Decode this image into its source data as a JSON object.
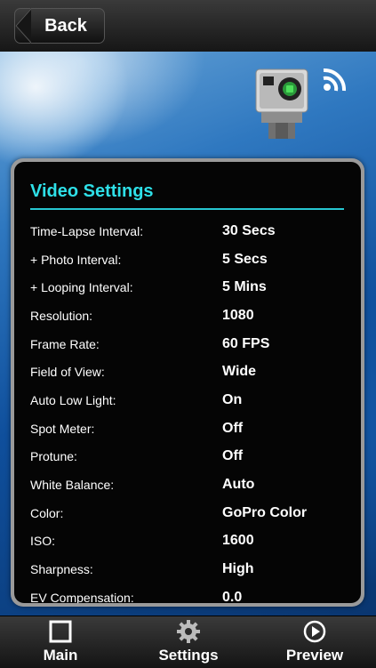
{
  "nav": {
    "back_label": "Back"
  },
  "panel": {
    "title": "Video Settings",
    "rows": [
      {
        "label": "Time-Lapse Interval:",
        "value": "30 Secs"
      },
      {
        "label": "+ Photo Interval:",
        "value": "5 Secs"
      },
      {
        "label": "+ Looping Interval:",
        "value": "5 Mins"
      },
      {
        "label": "Resolution:",
        "value": "1080"
      },
      {
        "label": "Frame Rate:",
        "value": "60 FPS"
      },
      {
        "label": "Field of View:",
        "value": "Wide"
      },
      {
        "label": "Auto Low Light:",
        "value": "On"
      },
      {
        "label": "Spot Meter:",
        "value": "Off"
      },
      {
        "label": "Protune:",
        "value": "Off"
      },
      {
        "label": "White Balance:",
        "value": "Auto"
      },
      {
        "label": "Color:",
        "value": "GoPro Color"
      },
      {
        "label": "ISO:",
        "value": "1600"
      },
      {
        "label": "Sharpness:",
        "value": "High"
      },
      {
        "label": "EV Compensation:",
        "value": "0.0"
      }
    ]
  },
  "tabs": [
    {
      "label": "Main",
      "icon": "square-icon"
    },
    {
      "label": "Settings",
      "icon": "gear-icon"
    },
    {
      "label": "Preview",
      "icon": "play-circle-icon"
    }
  ],
  "colors": {
    "accent": "#2ee0e8",
    "panel_bg": "#050505"
  }
}
